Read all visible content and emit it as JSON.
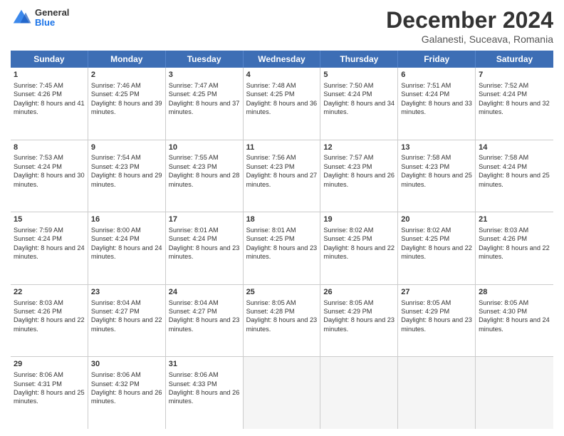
{
  "header": {
    "logo_general": "General",
    "logo_blue": "Blue",
    "main_title": "December 2024",
    "subtitle": "Galanesti, Suceava, Romania"
  },
  "calendar": {
    "days": [
      "Sunday",
      "Monday",
      "Tuesday",
      "Wednesday",
      "Thursday",
      "Friday",
      "Saturday"
    ],
    "weeks": [
      [
        {
          "day": "",
          "data": ""
        },
        {
          "day": "2",
          "rise": "Sunrise: 7:46 AM",
          "set": "Sunset: 4:25 PM",
          "daylight": "Daylight: 8 hours and 39 minutes."
        },
        {
          "day": "3",
          "rise": "Sunrise: 7:47 AM",
          "set": "Sunset: 4:25 PM",
          "daylight": "Daylight: 8 hours and 37 minutes."
        },
        {
          "day": "4",
          "rise": "Sunrise: 7:48 AM",
          "set": "Sunset: 4:25 PM",
          "daylight": "Daylight: 8 hours and 36 minutes."
        },
        {
          "day": "5",
          "rise": "Sunrise: 7:50 AM",
          "set": "Sunset: 4:24 PM",
          "daylight": "Daylight: 8 hours and 34 minutes."
        },
        {
          "day": "6",
          "rise": "Sunrise: 7:51 AM",
          "set": "Sunset: 4:24 PM",
          "daylight": "Daylight: 8 hours and 33 minutes."
        },
        {
          "day": "7",
          "rise": "Sunrise: 7:52 AM",
          "set": "Sunset: 4:24 PM",
          "daylight": "Daylight: 8 hours and 32 minutes."
        }
      ],
      [
        {
          "day": "8",
          "rise": "Sunrise: 7:53 AM",
          "set": "Sunset: 4:24 PM",
          "daylight": "Daylight: 8 hours and 30 minutes."
        },
        {
          "day": "9",
          "rise": "Sunrise: 7:54 AM",
          "set": "Sunset: 4:23 PM",
          "daylight": "Daylight: 8 hours and 29 minutes."
        },
        {
          "day": "10",
          "rise": "Sunrise: 7:55 AM",
          "set": "Sunset: 4:23 PM",
          "daylight": "Daylight: 8 hours and 28 minutes."
        },
        {
          "day": "11",
          "rise": "Sunrise: 7:56 AM",
          "set": "Sunset: 4:23 PM",
          "daylight": "Daylight: 8 hours and 27 minutes."
        },
        {
          "day": "12",
          "rise": "Sunrise: 7:57 AM",
          "set": "Sunset: 4:23 PM",
          "daylight": "Daylight: 8 hours and 26 minutes."
        },
        {
          "day": "13",
          "rise": "Sunrise: 7:58 AM",
          "set": "Sunset: 4:23 PM",
          "daylight": "Daylight: 8 hours and 25 minutes."
        },
        {
          "day": "14",
          "rise": "Sunrise: 7:58 AM",
          "set": "Sunset: 4:24 PM",
          "daylight": "Daylight: 8 hours and 25 minutes."
        }
      ],
      [
        {
          "day": "15",
          "rise": "Sunrise: 7:59 AM",
          "set": "Sunset: 4:24 PM",
          "daylight": "Daylight: 8 hours and 24 minutes."
        },
        {
          "day": "16",
          "rise": "Sunrise: 8:00 AM",
          "set": "Sunset: 4:24 PM",
          "daylight": "Daylight: 8 hours and 24 minutes."
        },
        {
          "day": "17",
          "rise": "Sunrise: 8:01 AM",
          "set": "Sunset: 4:24 PM",
          "daylight": "Daylight: 8 hours and 23 minutes."
        },
        {
          "day": "18",
          "rise": "Sunrise: 8:01 AM",
          "set": "Sunset: 4:25 PM",
          "daylight": "Daylight: 8 hours and 23 minutes."
        },
        {
          "day": "19",
          "rise": "Sunrise: 8:02 AM",
          "set": "Sunset: 4:25 PM",
          "daylight": "Daylight: 8 hours and 22 minutes."
        },
        {
          "day": "20",
          "rise": "Sunrise: 8:02 AM",
          "set": "Sunset: 4:25 PM",
          "daylight": "Daylight: 8 hours and 22 minutes."
        },
        {
          "day": "21",
          "rise": "Sunrise: 8:03 AM",
          "set": "Sunset: 4:26 PM",
          "daylight": "Daylight: 8 hours and 22 minutes."
        }
      ],
      [
        {
          "day": "22",
          "rise": "Sunrise: 8:03 AM",
          "set": "Sunset: 4:26 PM",
          "daylight": "Daylight: 8 hours and 22 minutes."
        },
        {
          "day": "23",
          "rise": "Sunrise: 8:04 AM",
          "set": "Sunset: 4:27 PM",
          "daylight": "Daylight: 8 hours and 22 minutes."
        },
        {
          "day": "24",
          "rise": "Sunrise: 8:04 AM",
          "set": "Sunset: 4:27 PM",
          "daylight": "Daylight: 8 hours and 23 minutes."
        },
        {
          "day": "25",
          "rise": "Sunrise: 8:05 AM",
          "set": "Sunset: 4:28 PM",
          "daylight": "Daylight: 8 hours and 23 minutes."
        },
        {
          "day": "26",
          "rise": "Sunrise: 8:05 AM",
          "set": "Sunset: 4:29 PM",
          "daylight": "Daylight: 8 hours and 23 minutes."
        },
        {
          "day": "27",
          "rise": "Sunrise: 8:05 AM",
          "set": "Sunset: 4:29 PM",
          "daylight": "Daylight: 8 hours and 23 minutes."
        },
        {
          "day": "28",
          "rise": "Sunrise: 8:05 AM",
          "set": "Sunset: 4:30 PM",
          "daylight": "Daylight: 8 hours and 24 minutes."
        }
      ],
      [
        {
          "day": "29",
          "rise": "Sunrise: 8:06 AM",
          "set": "Sunset: 4:31 PM",
          "daylight": "Daylight: 8 hours and 25 minutes."
        },
        {
          "day": "30",
          "rise": "Sunrise: 8:06 AM",
          "set": "Sunset: 4:32 PM",
          "daylight": "Daylight: 8 hours and 26 minutes."
        },
        {
          "day": "31",
          "rise": "Sunrise: 8:06 AM",
          "set": "Sunset: 4:33 PM",
          "daylight": "Daylight: 8 hours and 26 minutes."
        },
        {
          "day": "",
          "data": ""
        },
        {
          "day": "",
          "data": ""
        },
        {
          "day": "",
          "data": ""
        },
        {
          "day": "",
          "data": ""
        }
      ]
    ],
    "week1_day1": {
      "day": "1",
      "rise": "Sunrise: 7:45 AM",
      "set": "Sunset: 4:26 PM",
      "daylight": "Daylight: 8 hours and 41 minutes."
    }
  }
}
